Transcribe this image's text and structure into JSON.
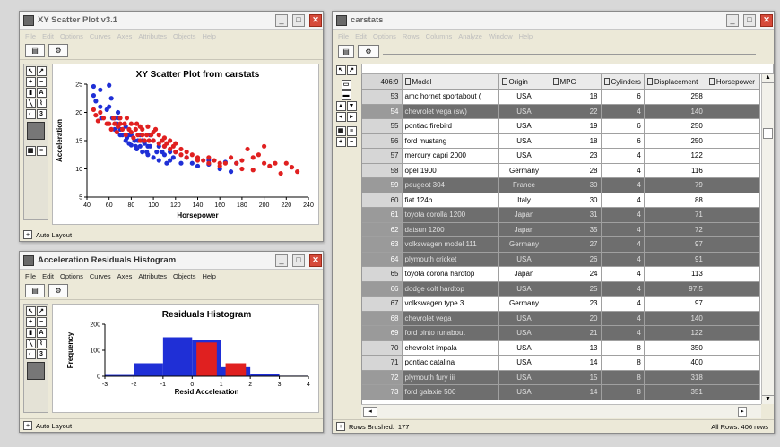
{
  "scatter_window": {
    "title": "XY Scatter Plot v3.1",
    "menus": [
      "File",
      "Edit",
      "Options",
      "Curves",
      "Axes",
      "Attributes",
      "Objects",
      "Help"
    ],
    "status": "Auto Layout",
    "chart_data": {
      "type": "scatter",
      "title": "XY Scatter Plot from carstats",
      "xlabel": "Horsepower",
      "ylabel": "Acceleration",
      "xlim": [
        40,
        240
      ],
      "ylim": [
        5,
        25
      ],
      "xticks": [
        40,
        60,
        80,
        100,
        120,
        140,
        160,
        180,
        200,
        220,
        240
      ],
      "yticks": [
        5,
        10,
        15,
        20,
        25
      ],
      "grid": false,
      "series": [
        {
          "color": "#1f2fd6",
          "points": [
            [
              46,
              23
            ],
            [
              46,
              24.6
            ],
            [
              48,
              22
            ],
            [
              52,
              21
            ],
            [
              52,
              24
            ],
            [
              53,
              19
            ],
            [
              58,
              20.5
            ],
            [
              60,
              21
            ],
            [
              60,
              24.8
            ],
            [
              62,
              22.5
            ],
            [
              63,
              19
            ],
            [
              65,
              19
            ],
            [
              65,
              17
            ],
            [
              67,
              18
            ],
            [
              68,
              20
            ],
            [
              69,
              19
            ],
            [
              70,
              17
            ],
            [
              70,
              16
            ],
            [
              72,
              16
            ],
            [
              75,
              15
            ],
            [
              75,
              17.5
            ],
            [
              76,
              15.5
            ],
            [
              78,
              16
            ],
            [
              78,
              14.5
            ],
            [
              80,
              16
            ],
            [
              80,
              14.2
            ],
            [
              83,
              15
            ],
            [
              84,
              14
            ],
            [
              85,
              13.5
            ],
            [
              86,
              15
            ],
            [
              88,
              14
            ],
            [
              88,
              16
            ],
            [
              90,
              15
            ],
            [
              90,
              13
            ],
            [
              92,
              14.5
            ],
            [
              94,
              13
            ],
            [
              95,
              14
            ],
            [
              95,
              12.5
            ],
            [
              97,
              14
            ],
            [
              97,
              16
            ],
            [
              100,
              12
            ],
            [
              100,
              15
            ],
            [
              103,
              13
            ],
            [
              105,
              11.5
            ],
            [
              105,
              14
            ],
            [
              108,
              13
            ],
            [
              110,
              12.5
            ],
            [
              110,
              14
            ],
            [
              112,
              11
            ],
            [
              115,
              13
            ],
            [
              115,
              11.5
            ],
            [
              118,
              12
            ],
            [
              120,
              13
            ],
            [
              125,
              11
            ],
            [
              130,
              12
            ],
            [
              135,
              11
            ],
            [
              140,
              10.5
            ],
            [
              150,
              10.8
            ],
            [
              150,
              11.5
            ],
            [
              160,
              10
            ],
            [
              165,
              11.2
            ],
            [
              170,
              9.5
            ],
            [
              175,
              11
            ]
          ]
        },
        {
          "color": "#e02020",
          "points": [
            [
              46,
              20.5
            ],
            [
              48,
              19.5
            ],
            [
              50,
              18.5
            ],
            [
              52,
              20
            ],
            [
              55,
              19
            ],
            [
              58,
              18
            ],
            [
              60,
              18
            ],
            [
              62,
              17
            ],
            [
              64,
              19
            ],
            [
              65,
              18
            ],
            [
              67,
              16.5
            ],
            [
              68,
              17.5
            ],
            [
              70,
              18
            ],
            [
              70,
              19
            ],
            [
              72,
              17
            ],
            [
              74,
              18
            ],
            [
              75,
              16
            ],
            [
              76,
              19
            ],
            [
              78,
              17
            ],
            [
              80,
              16.5
            ],
            [
              80,
              18
            ],
            [
              82,
              15.5
            ],
            [
              84,
              17
            ],
            [
              85,
              18
            ],
            [
              86,
              16
            ],
            [
              88,
              17.5
            ],
            [
              88,
              15
            ],
            [
              90,
              16
            ],
            [
              90,
              17
            ],
            [
              92,
              15
            ],
            [
              94,
              16
            ],
            [
              95,
              17.5
            ],
            [
              96,
              15
            ],
            [
              98,
              16
            ],
            [
              100,
              15
            ],
            [
              100,
              16.5
            ],
            [
              102,
              17
            ],
            [
              105,
              14.5
            ],
            [
              105,
              16
            ],
            [
              108,
              15
            ],
            [
              110,
              15.5
            ],
            [
              110,
              14
            ],
            [
              112,
              14.5
            ],
            [
              115,
              13.5
            ],
            [
              115,
              15
            ],
            [
              118,
              14
            ],
            [
              120,
              14.5
            ],
            [
              120,
              13
            ],
            [
              125,
              13.5
            ],
            [
              125,
              12.5
            ],
            [
              130,
              13
            ],
            [
              130,
              12
            ],
            [
              135,
              12.5
            ],
            [
              140,
              12
            ],
            [
              140,
              11.5
            ],
            [
              145,
              11.5
            ],
            [
              150,
              12
            ],
            [
              150,
              11
            ],
            [
              155,
              11.5
            ],
            [
              160,
              11
            ],
            [
              160,
              10.5
            ],
            [
              165,
              11
            ],
            [
              170,
              12
            ],
            [
              175,
              11
            ],
            [
              180,
              10
            ],
            [
              180,
              11.5
            ],
            [
              185,
              13.5
            ],
            [
              190,
              9.8
            ],
            [
              190,
              12
            ],
            [
              195,
              12.5
            ],
            [
              200,
              11
            ],
            [
              200,
              14
            ],
            [
              205,
              10.5
            ],
            [
              210,
              11
            ],
            [
              215,
              9.2
            ],
            [
              220,
              11
            ],
            [
              225,
              10.3
            ],
            [
              230,
              9.5
            ]
          ]
        }
      ]
    }
  },
  "histogram_window": {
    "title": "Acceleration Residuals Histogram",
    "menus": [
      "File",
      "Edit",
      "Options",
      "Curves",
      "Axes",
      "Attributes",
      "Objects",
      "Help"
    ],
    "status": "Auto Layout",
    "chart_data": {
      "type": "bar",
      "title": "Residuals Histogram",
      "xlabel": "Resid Acceleration",
      "ylabel": "Frequency",
      "xlim": [
        -3,
        4
      ],
      "ylim": [
        0,
        200
      ],
      "xticks": [
        -3,
        -2,
        -1,
        0,
        1,
        2,
        3,
        4
      ],
      "yticks": [
        0,
        100,
        200
      ],
      "bins": [
        -3,
        -2,
        -1,
        0,
        1,
        2,
        3,
        4
      ],
      "series": [
        {
          "color": "#1f2fd6",
          "values": [
            5,
            50,
            150,
            140,
            35,
            10,
            2
          ]
        },
        {
          "color": "#e02020",
          "values": [
            0,
            0,
            0,
            130,
            50,
            0,
            0
          ]
        }
      ]
    }
  },
  "table_window": {
    "title": "carstats",
    "menus": [
      "File",
      "Edit",
      "Options",
      "Rows",
      "Columns",
      "Analyze",
      "Window",
      "Help"
    ],
    "corner": "406:9",
    "columns": [
      "Model",
      "Origin",
      "MPG",
      "Cylinders",
      "Displacement",
      "Horsepower"
    ],
    "rows": [
      {
        "id": "53",
        "model": "amc hornet sportabout (",
        "origin": "USA",
        "mpg": "18",
        "cyl": "6",
        "disp": "258",
        "alt": false
      },
      {
        "id": "54",
        "model": "chevrolet vega (sw)",
        "origin": "USA",
        "mpg": "22",
        "cyl": "4",
        "disp": "140",
        "alt": true
      },
      {
        "id": "55",
        "model": "pontiac firebird",
        "origin": "USA",
        "mpg": "19",
        "cyl": "6",
        "disp": "250",
        "alt": false
      },
      {
        "id": "56",
        "model": "ford mustang",
        "origin": "USA",
        "mpg": "18",
        "cyl": "6",
        "disp": "250",
        "alt": false
      },
      {
        "id": "57",
        "model": "mercury capri 2000",
        "origin": "USA",
        "mpg": "23",
        "cyl": "4",
        "disp": "122",
        "alt": false
      },
      {
        "id": "58",
        "model": "opel 1900",
        "origin": "Germany",
        "mpg": "28",
        "cyl": "4",
        "disp": "116",
        "alt": false
      },
      {
        "id": "59",
        "model": "peugeot 304",
        "origin": "France",
        "mpg": "30",
        "cyl": "4",
        "disp": "79",
        "alt": true
      },
      {
        "id": "60",
        "model": "fiat 124b",
        "origin": "Italy",
        "mpg": "30",
        "cyl": "4",
        "disp": "88",
        "alt": false
      },
      {
        "id": "61",
        "model": "toyota corolla 1200",
        "origin": "Japan",
        "mpg": "31",
        "cyl": "4",
        "disp": "71",
        "alt": true
      },
      {
        "id": "62",
        "model": "datsun 1200",
        "origin": "Japan",
        "mpg": "35",
        "cyl": "4",
        "disp": "72",
        "alt": true
      },
      {
        "id": "63",
        "model": "volkswagen model 111",
        "origin": "Germany",
        "mpg": "27",
        "cyl": "4",
        "disp": "97",
        "alt": true
      },
      {
        "id": "64",
        "model": "plymouth cricket",
        "origin": "USA",
        "mpg": "26",
        "cyl": "4",
        "disp": "91",
        "alt": true
      },
      {
        "id": "65",
        "model": "toyota corona hardtop",
        "origin": "Japan",
        "mpg": "24",
        "cyl": "4",
        "disp": "113",
        "alt": false
      },
      {
        "id": "66",
        "model": "dodge colt hardtop",
        "origin": "USA",
        "mpg": "25",
        "cyl": "4",
        "disp": "97.5",
        "alt": true
      },
      {
        "id": "67",
        "model": "volkswagen type 3",
        "origin": "Germany",
        "mpg": "23",
        "cyl": "4",
        "disp": "97",
        "alt": false
      },
      {
        "id": "68",
        "model": "chevrolet vega",
        "origin": "USA",
        "mpg": "20",
        "cyl": "4",
        "disp": "140",
        "alt": true
      },
      {
        "id": "69",
        "model": "ford pinto runabout",
        "origin": "USA",
        "mpg": "21",
        "cyl": "4",
        "disp": "122",
        "alt": true
      },
      {
        "id": "70",
        "model": "chevrolet impala",
        "origin": "USA",
        "mpg": "13",
        "cyl": "8",
        "disp": "350",
        "alt": false
      },
      {
        "id": "71",
        "model": "pontiac catalina",
        "origin": "USA",
        "mpg": "14",
        "cyl": "8",
        "disp": "400",
        "alt": false
      },
      {
        "id": "72",
        "model": "plymouth fury iii",
        "origin": "USA",
        "mpg": "15",
        "cyl": "8",
        "disp": "318",
        "alt": true
      },
      {
        "id": "73",
        "model": "ford galaxie 500",
        "origin": "USA",
        "mpg": "14",
        "cyl": "8",
        "disp": "351",
        "alt": true
      }
    ],
    "status_left": "Rows Brushed:",
    "brushed_count": "177",
    "status_right": "All Rows: 406 rows"
  },
  "colors": {
    "blue": "#1f2fd6",
    "red": "#e02020"
  }
}
